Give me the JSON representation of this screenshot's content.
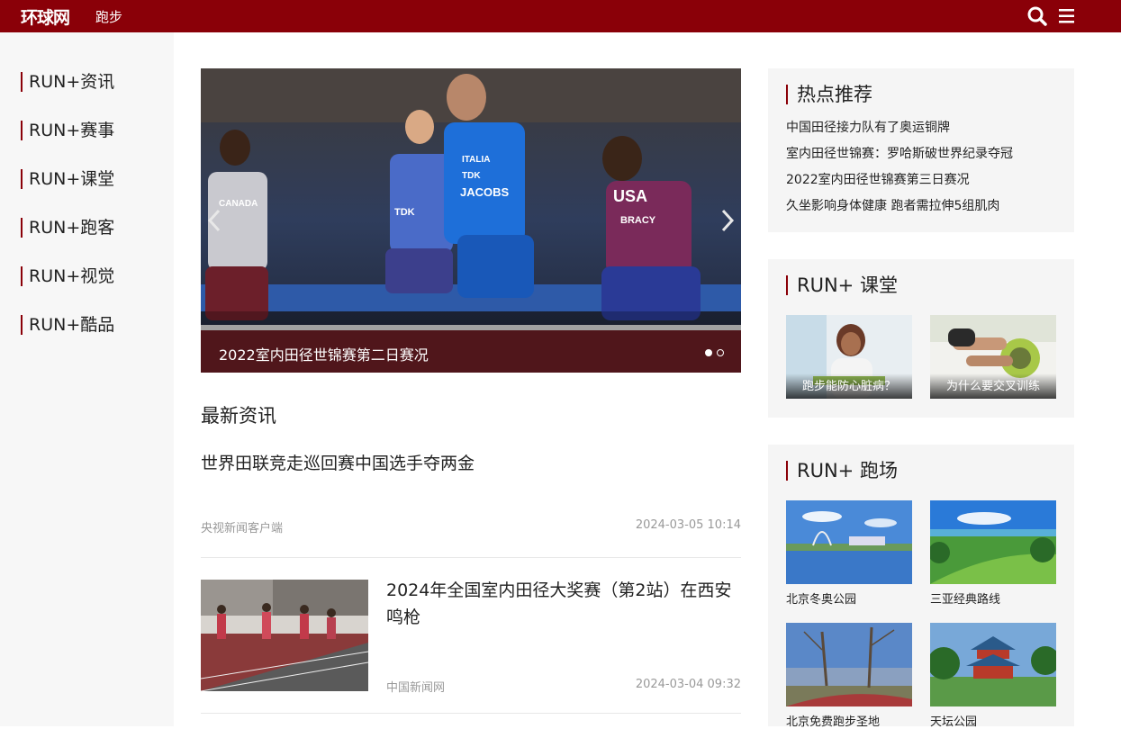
{
  "header": {
    "logo": "环球网",
    "channel": "跑步",
    "search_icon": "search-icon",
    "menu_icon": "hamburger-menu-icon",
    "bg_color": "#8a0008"
  },
  "sidebar": {
    "items": [
      {
        "label": "RUN+资讯"
      },
      {
        "label": "RUN+赛事"
      },
      {
        "label": "RUN+课堂"
      },
      {
        "label": "RUN+跑客"
      },
      {
        "label": "RUN+视觉"
      },
      {
        "label": "RUN+酷品"
      }
    ]
  },
  "carousel": {
    "caption": "2022室内田径世锦赛第二日赛况",
    "prev_icon": "chevron-left-icon",
    "next_icon": "chevron-right-icon",
    "slides": 2,
    "active_slide": 1,
    "jersey_labels": [
      "CANADA",
      "TDK",
      "ITALIA",
      "TDK",
      "JACOBS",
      "USA",
      "BRACY"
    ]
  },
  "latest_news": {
    "title": "最新资讯",
    "items": [
      {
        "title": "世界田联竞走巡回赛中国选手夺两金",
        "source": "央视新闻客户端",
        "time": "2024-03-05 10:14"
      },
      {
        "title": "2024年全国室内田径大奖赛（第2站）在西安鸣枪",
        "source": "中国新闻网",
        "time": "2024-03-04 09:32"
      }
    ]
  },
  "hot": {
    "title": "热点推荐",
    "links": [
      "中国田径接力队有了奥运铜牌",
      "室内田径世锦赛：罗哈斯破世界纪录夺冠",
      "2022室内田径世锦赛第三日赛况",
      "久坐影响身体健康 跑者需拉伸5组肌肉"
    ]
  },
  "classroom": {
    "title": "RUN+ 课堂",
    "items": [
      {
        "caption": "跑步能防心脏病？"
      },
      {
        "caption": "为什么要交叉训练"
      }
    ]
  },
  "venues": {
    "title": "RUN+ 跑场",
    "items": [
      {
        "label": "北京冬奥公园"
      },
      {
        "label": "三亚经典路线"
      },
      {
        "label": "北京免费跑步圣地"
      },
      {
        "label": "天坛公园"
      }
    ]
  }
}
